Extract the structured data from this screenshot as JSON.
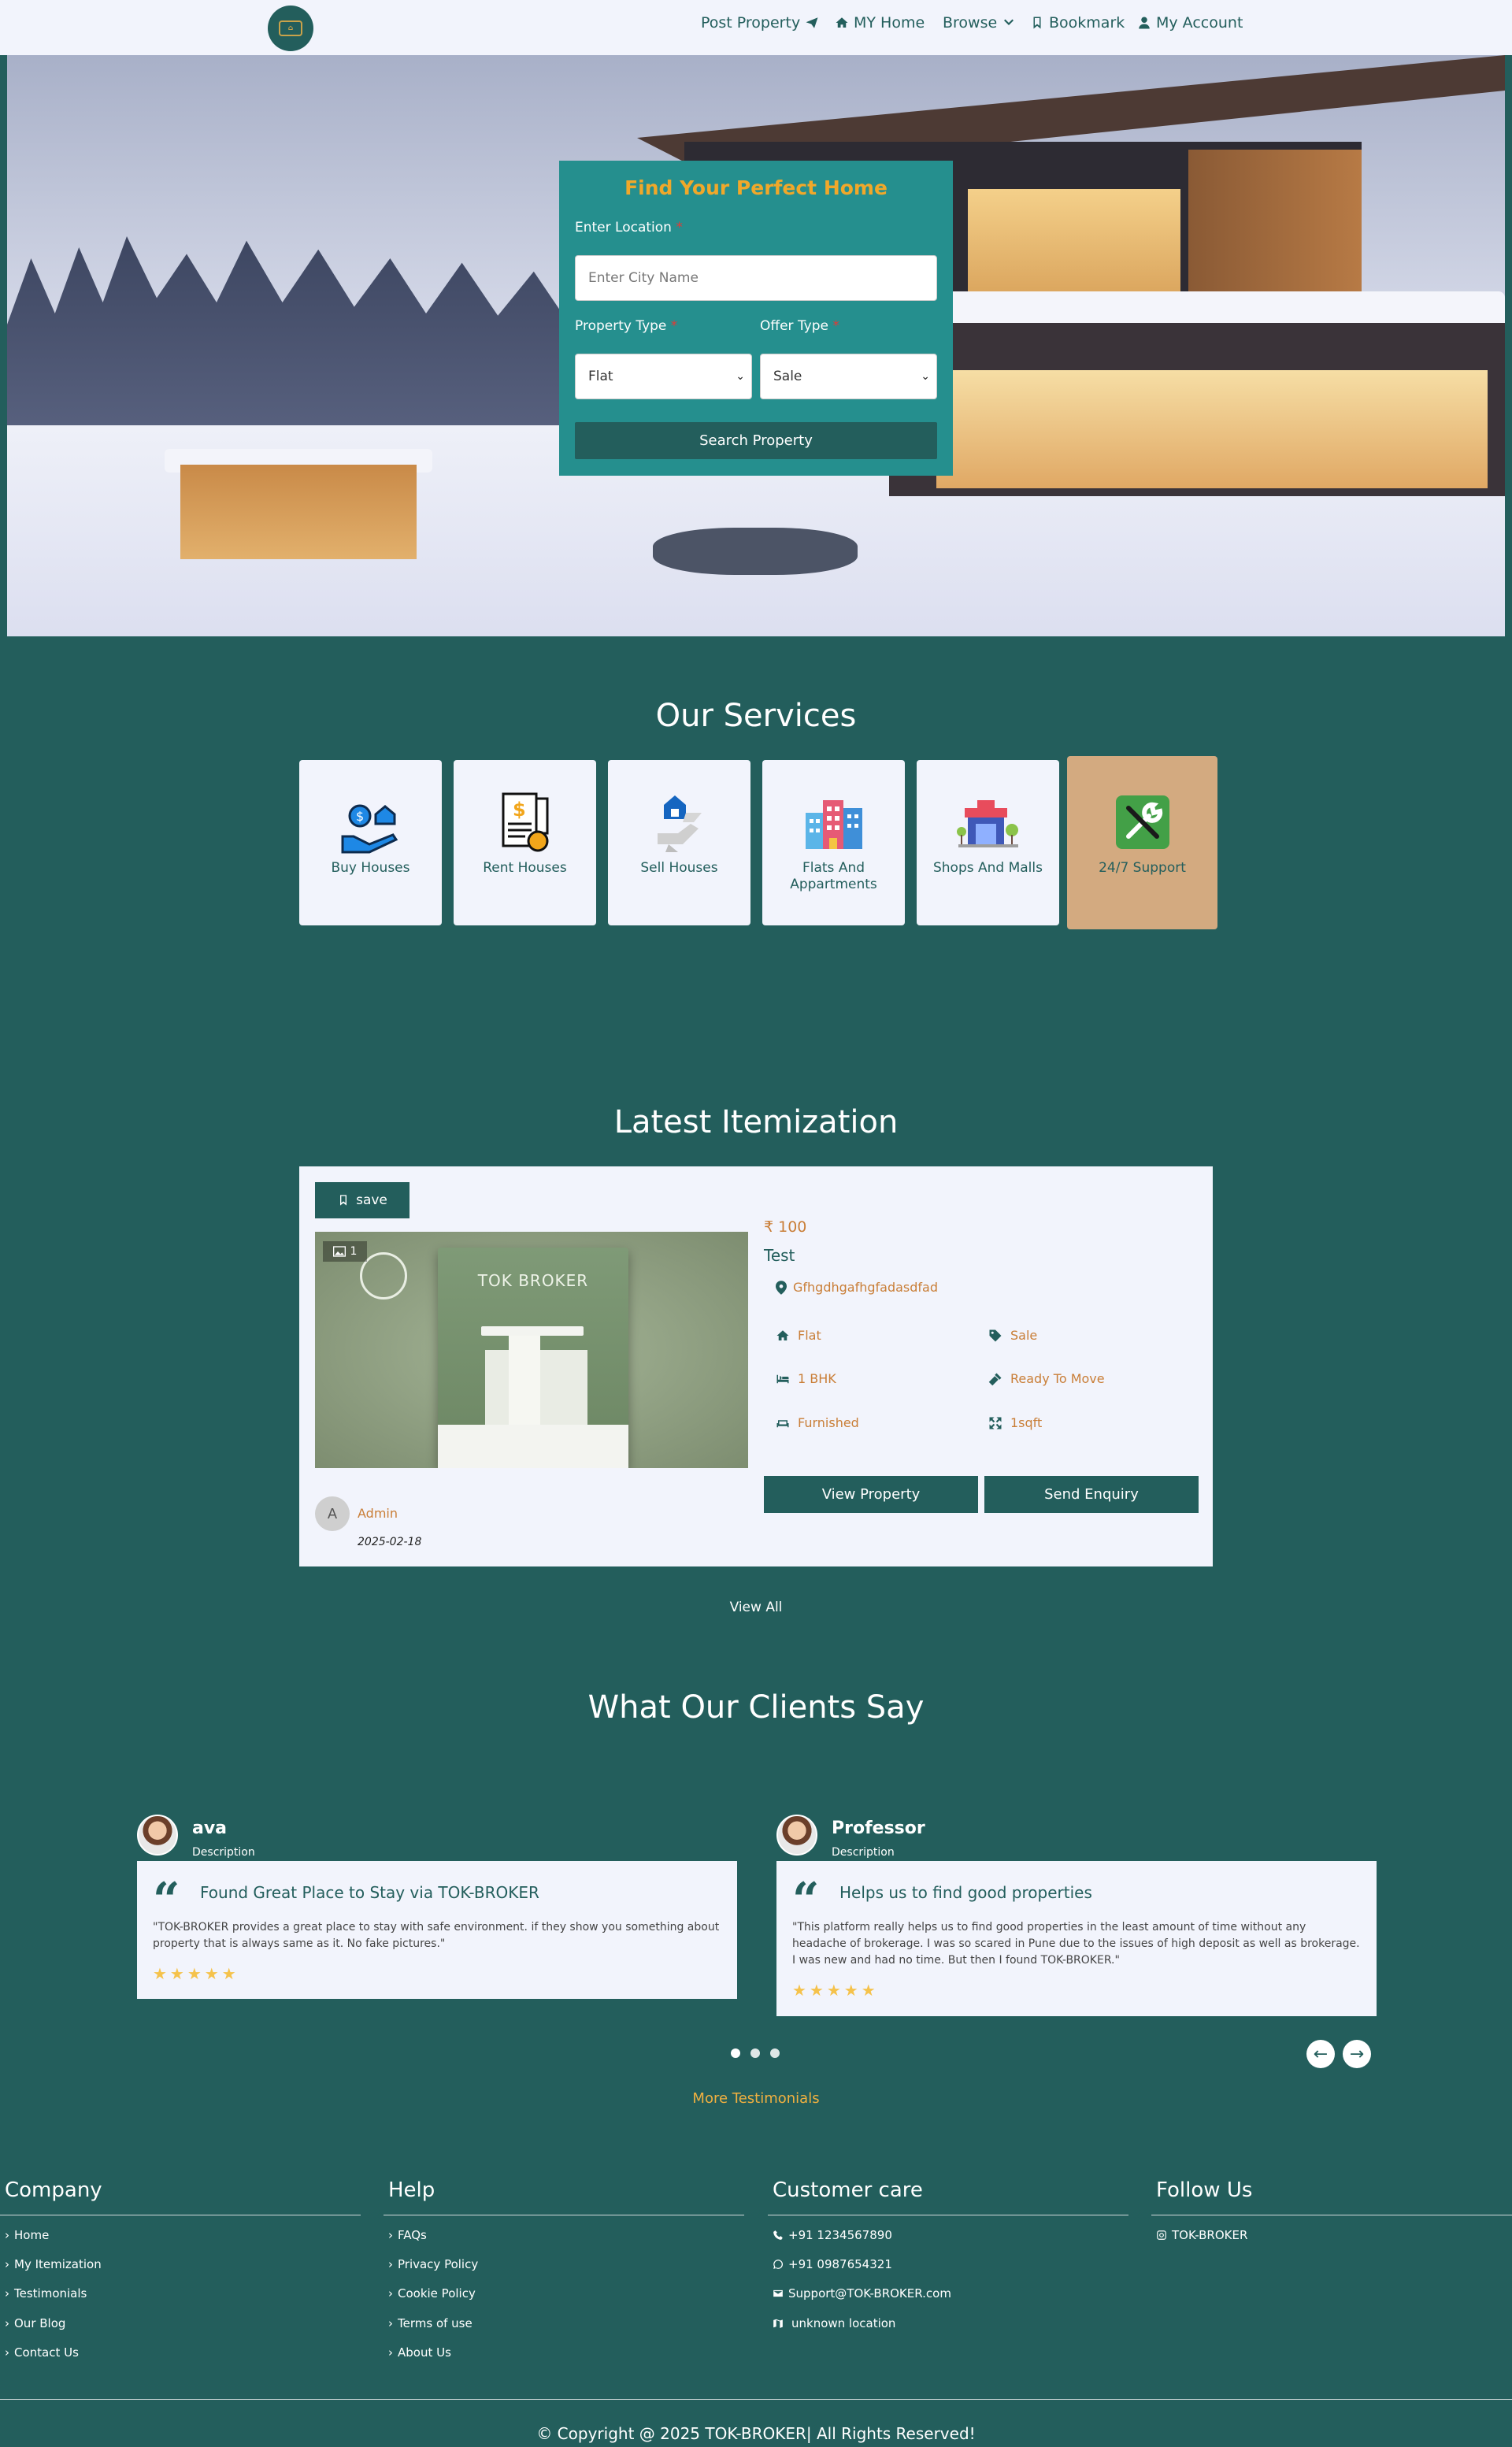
{
  "header": {
    "nav": [
      "Post Property",
      "MY Home",
      "Browse",
      "Bookmark",
      "My Account"
    ]
  },
  "hero": {
    "search": {
      "title": "Find Your Perfect Home",
      "location_label": "Enter Location",
      "location_placeholder": "Enter City Name",
      "property_type_label": "Property Type",
      "property_type_value": "Flat",
      "offer_type_label": "Offer Type",
      "offer_type_value": "Sale",
      "required_mark": "*",
      "button": "Search Property"
    }
  },
  "services": {
    "title": "Our Services",
    "items": [
      {
        "label": "Buy Houses",
        "icon": "buy-house-icon"
      },
      {
        "label": "Rent Houses",
        "icon": "rent-document-icon"
      },
      {
        "label": "Sell Houses",
        "icon": "sell-house-icon"
      },
      {
        "label": "Flats And Appartments",
        "icon": "buildings-icon"
      },
      {
        "label": "Shops And Malls",
        "icon": "shop-icon"
      },
      {
        "label": "24/7 Support",
        "icon": "tools-icon"
      }
    ]
  },
  "latest": {
    "title": "Latest Itemization",
    "save_label": "save",
    "image_count": "1",
    "thumb_brand": "TOK BROKER",
    "price": "₹ 100",
    "name": "Test",
    "address": "Gfhgdhgafhgfadasdfad",
    "attributes": {
      "type": "Flat",
      "offer": "Sale",
      "bhk": "1 BHK",
      "status": "Ready To Move",
      "furnishing": "Furnished",
      "area": "1sqft"
    },
    "view_button": "View Property",
    "enquiry_button": "Send Enquiry",
    "avatar_initial": "A",
    "poster": "Admin",
    "date": "2025-02-18",
    "view_all": "View All"
  },
  "testimonials": {
    "title": "What Our Clients Say",
    "items": [
      {
        "name": "ava",
        "desc": "Description",
        "heading": "Found Great Place to Stay via TOK-BROKER",
        "body": "\"TOK-BROKER provides a great place to stay with safe environment. if they show you something about property that is always same as it. No fake pictures.\"",
        "stars": "★★★★★"
      },
      {
        "name": "Professor",
        "desc": "Description",
        "heading": "Helps us to find good properties",
        "body": "\"This platform really helps us to find good properties in the least amount of time without any headache of brokerage. I was so scared in Pune due to the issues of high deposit as well as brokerage. I was new and had no time. But then I found TOK-BROKER.\"",
        "stars": "★★★★★"
      }
    ],
    "more": "More Testimonials"
  },
  "footer": {
    "company": {
      "title": "Company",
      "links": [
        "Home",
        "My Itemization",
        "Testimonials",
        "Our Blog",
        "Contact Us"
      ]
    },
    "help": {
      "title": "Help",
      "links": [
        "FAQs",
        "Privacy Policy",
        "Cookie Policy",
        "Terms of use",
        "About Us"
      ]
    },
    "care": {
      "title": "Customer care",
      "phone": "+91 1234567890",
      "whatsapp": "+91 0987654321",
      "email": "Support@TOK-BROKER.com",
      "location": "unknown location"
    },
    "follow": {
      "title": "Follow Us",
      "instagram": "TOK-BROKER"
    },
    "copyright": "© Copyright @ 2025 TOK-BROKER| All Rights Reserved!"
  },
  "colors": {
    "primary": "#235e5c",
    "accent": "#c97e37",
    "gold": "#f0a82a",
    "card": "#f2f4fc",
    "support_tile": "#d3aa80"
  }
}
